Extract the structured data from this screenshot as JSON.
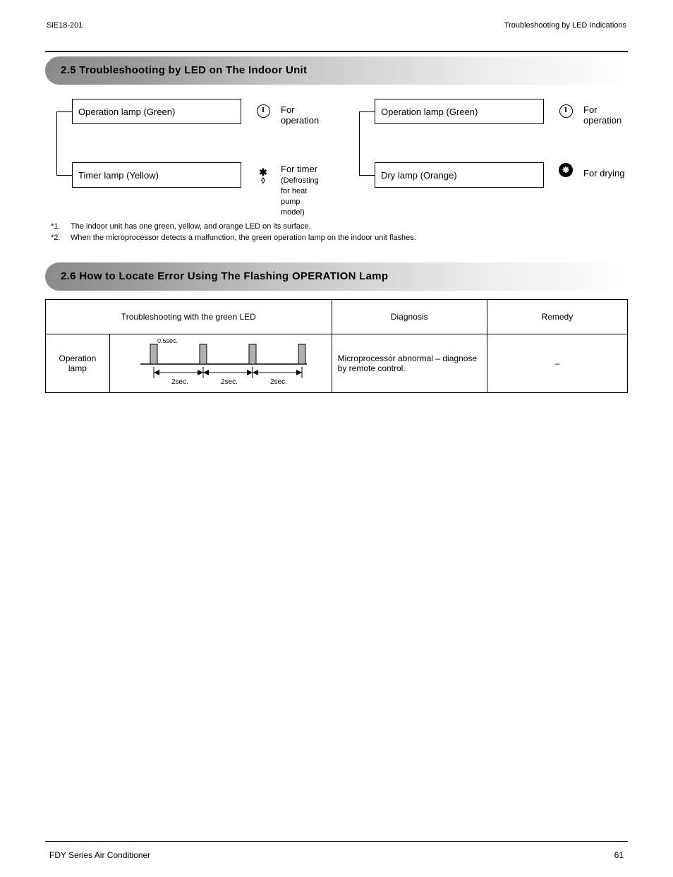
{
  "header": {
    "left": "SiE18-201",
    "right": "Troubleshooting by LED Indications"
  },
  "sections": {
    "indoor_title": "2.5 Troubleshooting by LED on The Indoor Unit",
    "error_title": "2.6 How to Locate Error Using The Flashing OPERATION Lamp"
  },
  "indoor": {
    "left": {
      "top_box": "Operation lamp (Green)",
      "top_icon_label": "For operation",
      "bot_box": "Timer lamp (Yellow)",
      "bot_icon_label_line1": "For timer",
      "bot_icon_label_line2": "(Defrosting for heat pump model)"
    },
    "right": {
      "top_box": "Operation lamp (Green)",
      "top_icon_label": "For operation",
      "bot_box": "Dry lamp (Orange)",
      "bot_icon_label": "For drying"
    },
    "footnotes": [
      "The indoor unit has one green, yellow, and orange LED on its surface.",
      "When the microprocessor detects a malfunction, the green operation lamp on the indoor unit flashes."
    ]
  },
  "err_table": {
    "headers": [
      "Troubleshooting with the green LED",
      "Diagnosis",
      "Remedy"
    ],
    "row1": {
      "label_line1": "Operation",
      "label_line2": "lamp",
      "timing": "2sec.",
      "pulse": "0.5sec.",
      "diagnosis": "Microprocessor abnormal – diagnose by remote control.",
      "remedy": "–"
    }
  },
  "footer": {
    "product_line": "FDY Series Air Conditioner",
    "page": "61"
  }
}
